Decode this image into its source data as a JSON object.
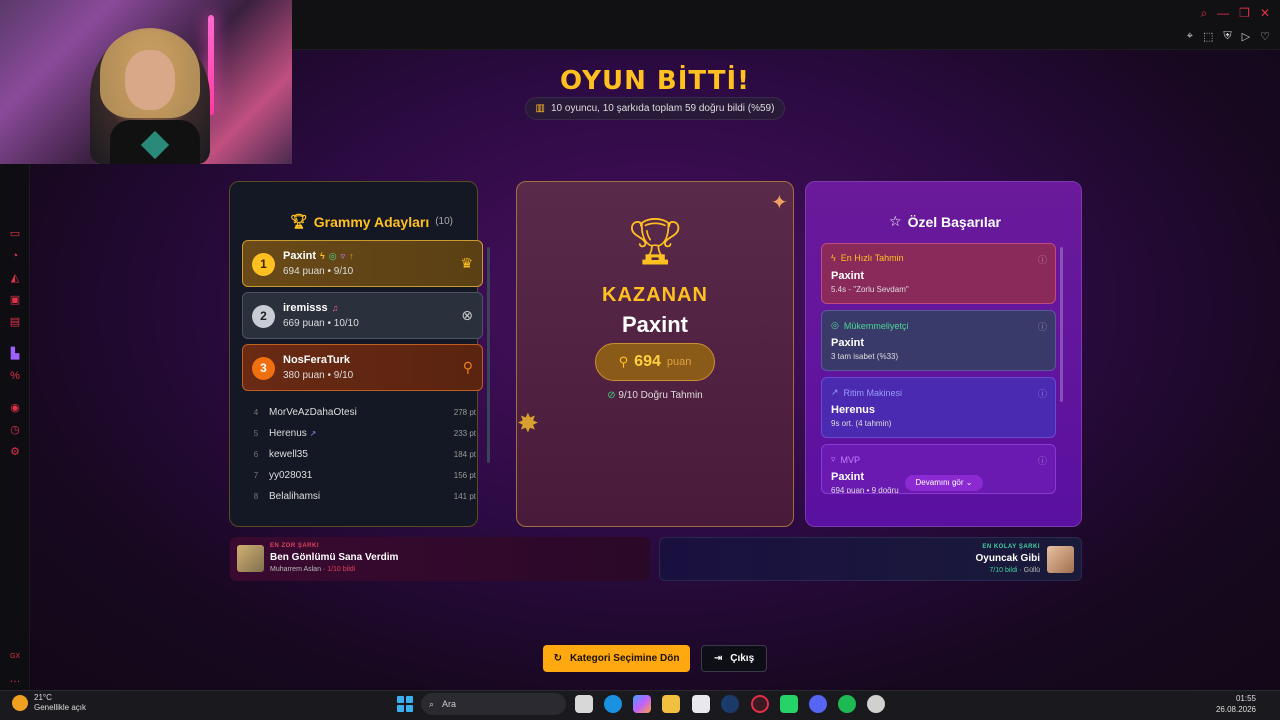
{
  "header": {
    "title": "OYUN BİTTİ!",
    "summary": "10 oyuncu, 10 şarkıda toplam 59 doğru bildi (%59)"
  },
  "leaderboard": {
    "title": "Grammy Adayları",
    "count": "(10)",
    "top": [
      {
        "rank": "1",
        "name": "Paxint",
        "score": "694 puan • 9/10"
      },
      {
        "rank": "2",
        "name": "iremisss",
        "score": "669 puan • 10/10"
      },
      {
        "rank": "3",
        "name": "NosFeraTurk",
        "score": "380 puan • 9/10"
      }
    ],
    "rest": [
      {
        "rank": "4",
        "name": "MorVeAzDahaOtesi",
        "points": "278 pt"
      },
      {
        "rank": "5",
        "name": "Herenus",
        "points": "233 pt"
      },
      {
        "rank": "6",
        "name": "kewell35",
        "points": "184 pt"
      },
      {
        "rank": "7",
        "name": "yy028031",
        "points": "156 pt"
      },
      {
        "rank": "8",
        "name": "Belalihamsi",
        "points": "141 pt"
      }
    ]
  },
  "winner": {
    "label": "KAZANAN",
    "name": "Paxint",
    "points": "694",
    "points_unit": "puan",
    "correct": "9/10 Doğru Tahmin"
  },
  "achievements": {
    "title": "Özel Başarılar",
    "items": [
      {
        "title": "En Hızlı Tahmin",
        "name": "Paxint",
        "desc": "5.4s - \"Zorlu Sevdam\""
      },
      {
        "title": "Mükemmeliyetçi",
        "name": "Paxint",
        "desc": "3 tam isabet (%33)"
      },
      {
        "title": "Ritim Makinesi",
        "name": "Herenus",
        "desc": "9s ort. (4 tahmin)"
      },
      {
        "title": "MVP",
        "name": "Paxint",
        "desc": "694 puan • 9 doğru"
      }
    ],
    "more": "Devamını gör"
  },
  "songs": {
    "hardest": {
      "kicker": "EN ZOR ŞARKI",
      "title": "Ben Gönlümü Sana Verdim",
      "artist": "Muharrem Aslan · ",
      "stat": "1/10 bildi"
    },
    "easiest": {
      "kicker": "EN KOLAY ŞARKI",
      "title": "Oyuncak Gibi",
      "stat": "7/10 bildi",
      "artist": " · Güllü"
    }
  },
  "buttons": {
    "category": "Kategori Seçimine Dön",
    "exit": "Çıkış"
  },
  "taskbar": {
    "temp": "21°C",
    "weather": "Genellikle açık",
    "search": "Ara",
    "time": "01:55",
    "date": "26.08.2026"
  },
  "sidebar": {
    "bottom_label": "GX"
  },
  "colors": {
    "accent": "#ffc020",
    "browser_accent": "#e0304a",
    "purple": "#6a1ab0"
  }
}
